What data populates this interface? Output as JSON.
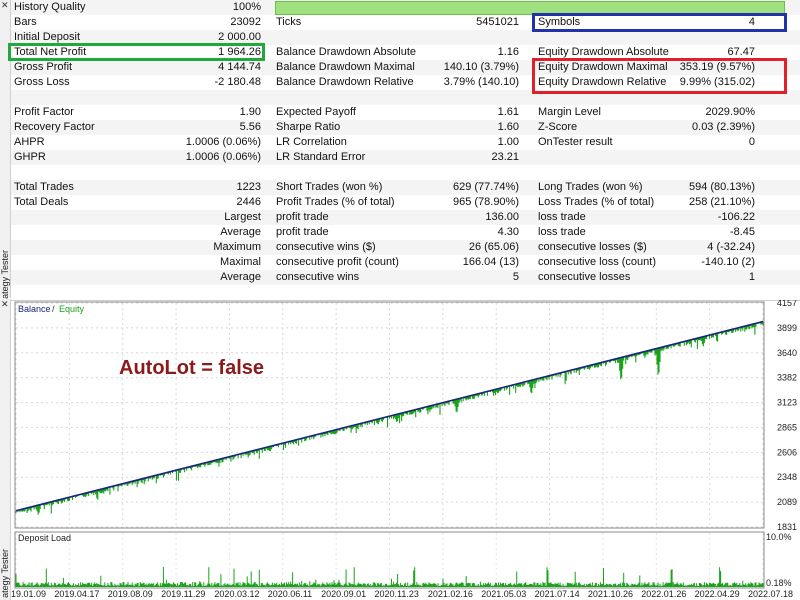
{
  "side_panel": {
    "label": "ategy Tester",
    "close_glyph": "✕"
  },
  "report": {
    "rows": [
      {
        "cells": [
          {
            "l": "History Quality",
            "v": "100%"
          },
          {
            "l": "",
            "v": ""
          },
          {
            "l": "",
            "v": ""
          }
        ],
        "quality_bar_percent": 100
      },
      {
        "cells": [
          {
            "l": "Bars",
            "v": "23092"
          },
          {
            "l": "Ticks",
            "v": "5451021"
          },
          {
            "l": "Symbols",
            "v": "4"
          }
        ]
      },
      {
        "cells": [
          {
            "l": "Initial Deposit",
            "v": "2 000.00"
          },
          {
            "l": "",
            "v": ""
          },
          {
            "l": "",
            "v": ""
          }
        ]
      },
      {
        "cells": [
          {
            "l": "Total Net Profit",
            "v": "1 964.26"
          },
          {
            "l": "Balance Drawdown Absolute",
            "v": "1.16"
          },
          {
            "l": "Equity Drawdown Absolute",
            "v": "67.47"
          }
        ]
      },
      {
        "cells": [
          {
            "l": "Gross Profit",
            "v": "4 144.74"
          },
          {
            "l": "Balance Drawdown Maximal",
            "v": "140.10 (3.79%)"
          },
          {
            "l": "Equity Drawdown Maximal",
            "v": "353.19 (9.57%)"
          }
        ]
      },
      {
        "cells": [
          {
            "l": "Gross Loss",
            "v": "-2 180.48"
          },
          {
            "l": "Balance Drawdown Relative",
            "v": "3.79% (140.10)"
          },
          {
            "l": "Equity Drawdown Relative",
            "v": "9.99% (315.02)"
          }
        ]
      },
      {
        "cells": [
          {
            "l": "",
            "v": ""
          },
          {
            "l": "",
            "v": ""
          },
          {
            "l": "",
            "v": ""
          }
        ]
      },
      {
        "cells": [
          {
            "l": "Profit Factor",
            "v": "1.90"
          },
          {
            "l": "Expected Payoff",
            "v": "1.61"
          },
          {
            "l": "Margin Level",
            "v": "2029.90%"
          }
        ]
      },
      {
        "cells": [
          {
            "l": "Recovery Factor",
            "v": "5.56"
          },
          {
            "l": "Sharpe Ratio",
            "v": "1.60"
          },
          {
            "l": "Z-Score",
            "v": "0.03 (2.39%)"
          }
        ]
      },
      {
        "cells": [
          {
            "l": "AHPR",
            "v": "1.0006 (0.06%)"
          },
          {
            "l": "LR Correlation",
            "v": "1.00"
          },
          {
            "l": "OnTester result",
            "v": "0"
          }
        ]
      },
      {
        "cells": [
          {
            "l": "GHPR",
            "v": "1.0006 (0.06%)"
          },
          {
            "l": "LR Standard Error",
            "v": "23.21"
          },
          {
            "l": "",
            "v": ""
          }
        ]
      },
      {
        "cells": [
          {
            "l": "",
            "v": ""
          },
          {
            "l": "",
            "v": ""
          },
          {
            "l": "",
            "v": ""
          }
        ]
      },
      {
        "cells": [
          {
            "l": "Total Trades",
            "v": "1223"
          },
          {
            "l": "Short Trades (won %)",
            "v": "629 (77.74%)"
          },
          {
            "l": "Long Trades (won %)",
            "v": "594 (80.13%)"
          }
        ]
      },
      {
        "cells": [
          {
            "l": "Total Deals",
            "v": "2446"
          },
          {
            "l": "Profit Trades (% of total)",
            "v": "965 (78.90%)"
          },
          {
            "l": "Loss Trades (% of total)",
            "v": "258 (21.10%)"
          }
        ]
      },
      {
        "cells": [
          {
            "l": "",
            "v": "Largest"
          },
          {
            "l": "profit trade",
            "v": "136.00"
          },
          {
            "l": "loss trade",
            "v": "-106.22"
          }
        ]
      },
      {
        "cells": [
          {
            "l": "",
            "v": "Average"
          },
          {
            "l": "profit trade",
            "v": "4.30"
          },
          {
            "l": "loss trade",
            "v": "-8.45"
          }
        ]
      },
      {
        "cells": [
          {
            "l": "",
            "v": "Maximum"
          },
          {
            "l": "consecutive wins ($)",
            "v": "26 (65.06)"
          },
          {
            "l": "consecutive losses ($)",
            "v": "4 (-32.24)"
          }
        ]
      },
      {
        "cells": [
          {
            "l": "",
            "v": "Maximal"
          },
          {
            "l": "consecutive profit (count)",
            "v": "166.04 (13)"
          },
          {
            "l": "consecutive loss (count)",
            "v": "-140.10 (2)"
          }
        ]
      },
      {
        "cells": [
          {
            "l": "",
            "v": "Average"
          },
          {
            "l": "consecutive wins",
            "v": "5"
          },
          {
            "l": "consecutive losses",
            "v": "1"
          }
        ]
      }
    ],
    "highlight_colors": {
      "total_net_profit": "#1faa3a",
      "symbols": "#2233aa",
      "equity_drawdown": "#e0202a"
    }
  },
  "chart_data": [
    {
      "type": "line",
      "legend": [
        {
          "name": "Balance",
          "color": "#1a237e"
        },
        {
          "name": "Equity",
          "color": "#1aa31a"
        }
      ],
      "legend_separator": "/",
      "annotation": "AutoLot = false",
      "y_ticks": [
        4157,
        3899,
        3640,
        3382,
        3123,
        2865,
        2606,
        2348,
        2089,
        1831
      ],
      "ylim": [
        1831,
        4157
      ],
      "x_ticks": [
        "2019.01.09",
        "2019.04.17",
        "2019.08.09",
        "2019.11.29",
        "2020.03.12",
        "2020.06.11",
        "2020.09.01",
        "2020.11.23",
        "2021.02.16",
        "2021.05.03",
        "2021.07.14",
        "2021.10.26",
        "2022.01.26",
        "2022.04.29",
        "2022.07.18"
      ],
      "balance": {
        "start": 2000,
        "end": 3964
      },
      "equity_dips": [
        {
          "x": 0.03,
          "y": 1950
        },
        {
          "x": 0.13,
          "y": 2300
        },
        {
          "x": 0.26,
          "y": 2470
        },
        {
          "x": 0.34,
          "y": 2610
        },
        {
          "x": 0.51,
          "y": 2910
        },
        {
          "x": 0.59,
          "y": 3000
        },
        {
          "x": 0.69,
          "y": 3200
        },
        {
          "x": 0.81,
          "y": 3330
        },
        {
          "x": 0.86,
          "y": 3370
        },
        {
          "x": 0.92,
          "y": 3700
        }
      ]
    },
    {
      "type": "bar",
      "title": "Deposit Load",
      "y_ticks": [
        "10.0%",
        "0.18%"
      ],
      "ylim": [
        0,
        10
      ]
    }
  ]
}
